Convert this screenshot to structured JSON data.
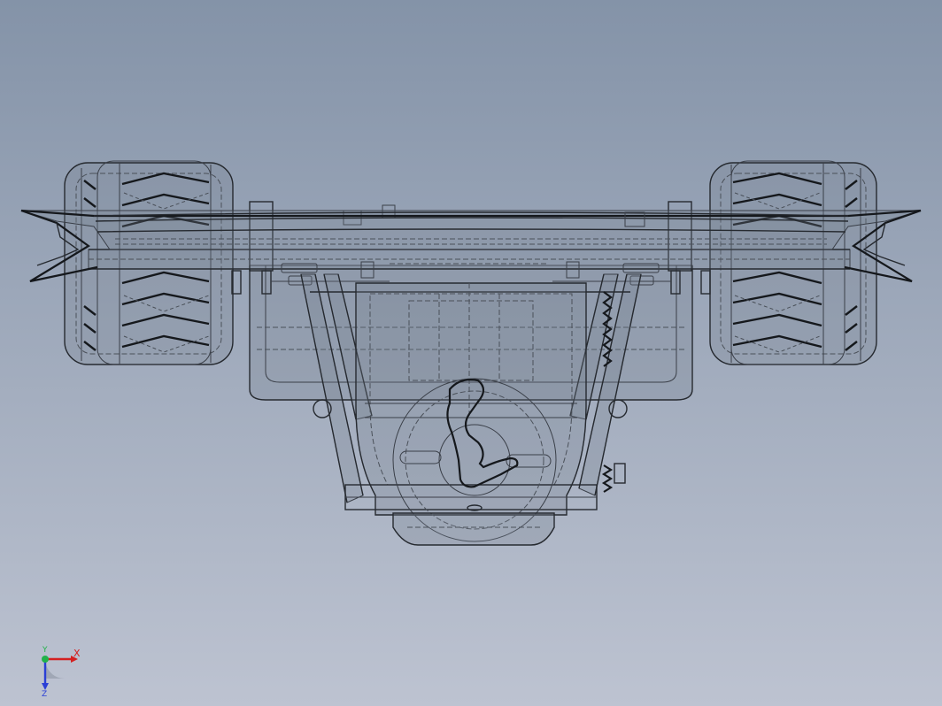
{
  "colors": {
    "background_top": "#8493a8",
    "background_bottom": "#bdc3d1",
    "line": "#15181c",
    "x_axis": "#d42020",
    "y_axis": "#21b24a",
    "z_axis": "#2a3fd6"
  },
  "triad": {
    "x_label": "X",
    "y_label": "Y",
    "z_label": "Z"
  }
}
